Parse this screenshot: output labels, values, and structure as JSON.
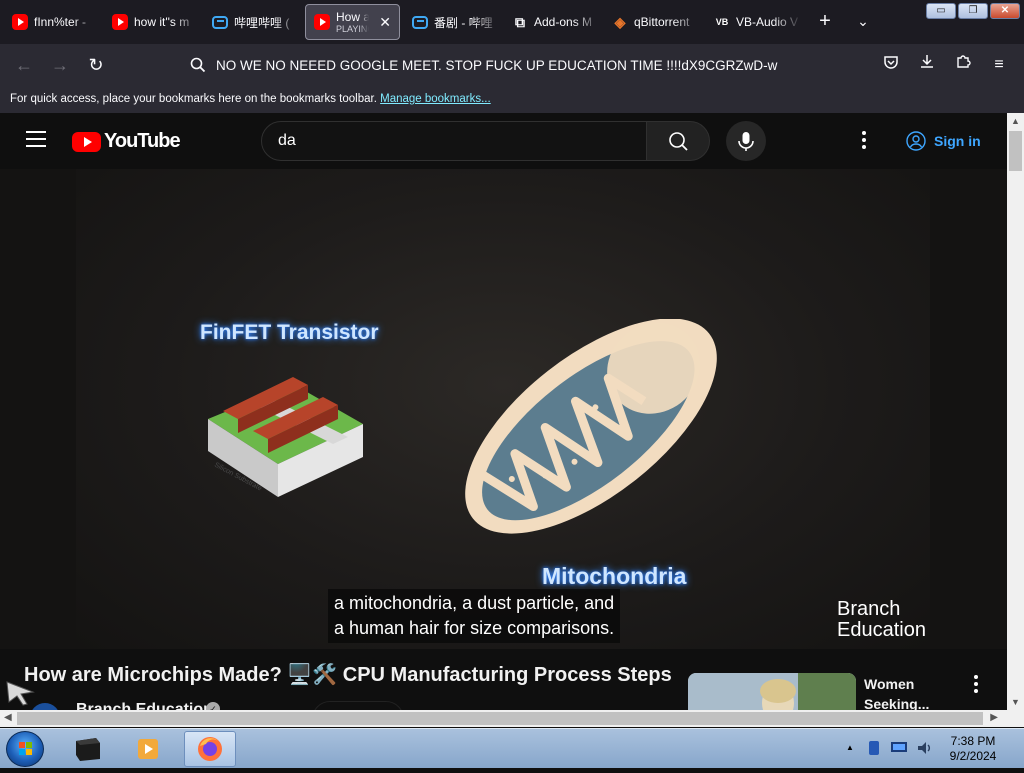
{
  "browser": {
    "tabs": [
      {
        "label": "fInn%ter -",
        "icon": "youtube-icon",
        "active": false
      },
      {
        "label": "how it''s m",
        "icon": "youtube-icon",
        "active": false
      },
      {
        "label": "哔哩哔哩 (",
        "icon": "bilibili-icon",
        "active": false
      },
      {
        "label": "How are",
        "sublabel": "PLAYING",
        "icon": "youtube-icon",
        "active": true
      },
      {
        "label": "番剧 - 哔哩",
        "icon": "bilibili-icon",
        "active": false
      },
      {
        "label": "Add-ons M",
        "icon": "puzzle-icon",
        "active": false
      },
      {
        "label": "qBittorrent",
        "icon": "qbittorrent-icon",
        "active": false
      },
      {
        "label": "VB-Audio V",
        "icon": "vb-audio-icon",
        "active": false
      }
    ],
    "url": "NO WE NO NEEED GOOGLE MEET. STOP FUCK UP EDUCATION TIME !!!!dX9CGRZwD-w",
    "bookmarks_text": "For quick access, place your bookmarks here on the bookmarks toolbar.",
    "bookmarks_link": "Manage bookmarks..."
  },
  "youtube": {
    "logo_text": "YouTube",
    "search_value": "da",
    "signin_label": "Sign in",
    "video": {
      "finfet_label": "FinFET Transistor",
      "substrate_label": "Silicon Substrate",
      "mito_label": "Mitochondria",
      "caption_line1": "a mitochondria, a dust particle, and",
      "caption_line2": "a human hair for size comparisons.",
      "watermark_line1": "Branch",
      "watermark_line2": "Education"
    },
    "title": "How are Microchips Made? 🖥️🛠️ CPU Manufacturing Process Steps",
    "channel": "Branch Education",
    "recommended": {
      "title_line1": "Women",
      "title_line2": "Seeking..."
    }
  },
  "taskbar": {
    "time": "7:38 PM",
    "date": "9/2/2024"
  },
  "colors": {
    "youtube_red": "#ff0000",
    "link_blue": "#3ea6ff",
    "browser_bg": "#1c1b22",
    "taskbar_blue": "#a9c1dd"
  }
}
